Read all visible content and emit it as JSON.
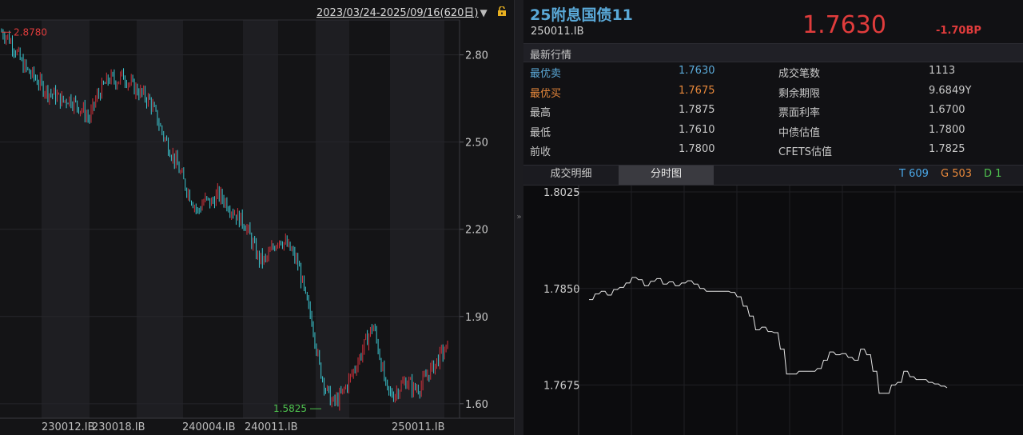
{
  "left_chart": {
    "date_range": "2023/03/24-2025/09/16(620日)",
    "range_menu_icon": "triangle-down",
    "lock_icon": "lock",
    "high_marker": "2.8780",
    "low_marker": "1.5825",
    "y_ticks": [
      "2.80",
      "2.50",
      "2.20",
      "1.90",
      "1.60"
    ],
    "x_labels": [
      "230012.IB",
      "230018.IB",
      "240004.IB",
      "240011.IB",
      "250011.IB"
    ],
    "up_color": "#d2323c",
    "down_color": "#3cc8d2"
  },
  "splitter_icon": "»",
  "header": {
    "bond_name": "25附息国债11",
    "bond_code": "250011.IB",
    "last_price": "1.7630",
    "change_bp": "-1.70BP"
  },
  "quote_section": {
    "title": "最新行情",
    "rows": [
      {
        "label1": "最优卖",
        "value1": "1.7630",
        "label2": "成交笔数",
        "value2": "1113"
      },
      {
        "label1": "最优买",
        "value1": "1.7675",
        "label2": "剩余期限",
        "value2": "9.6849Y"
      },
      {
        "label1": "最高",
        "value1": "1.7875",
        "label2": "票面利率",
        "value2": "1.6700"
      },
      {
        "label1": "最低",
        "value1": "1.7610",
        "label2": "中债估值",
        "value2": "1.7800"
      },
      {
        "label1": "前收",
        "value1": "1.7800",
        "label2": "CFETS估值",
        "value2": "1.7825"
      }
    ]
  },
  "tabs": {
    "trade_details": "成交明细",
    "intraday": "分时图",
    "t_count": "T 609",
    "g_count": "G 503",
    "d_count": "D 1"
  },
  "colors": {
    "accent_blue": "#5aa9d8",
    "price_red": "#e03c3c",
    "ask_color": "#5aa9d8",
    "bid_color": "#e8883a",
    "t_color": "#4aa8e8",
    "g_color": "#e8883a",
    "d_color": "#4fc34f"
  },
  "chart_data": [
    {
      "type": "candlestick",
      "title": "2023/03/24-2025/09/16(620日)",
      "y_ticks": [
        2.8,
        2.5,
        2.2,
        1.9,
        1.6
      ],
      "ylim": [
        1.55,
        2.92
      ],
      "x_labels": [
        "230012.IB",
        "230018.IB",
        "240004.IB",
        "240011.IB",
        "250011.IB"
      ],
      "annotations": [
        {
          "label": "2.8780",
          "y": 2.878
        },
        {
          "label": "1.5825",
          "y": 1.5825
        }
      ],
      "trend_values": [
        2.88,
        2.86,
        2.82,
        2.77,
        2.74,
        2.72,
        2.69,
        2.67,
        2.66,
        2.64,
        2.65,
        2.63,
        2.61,
        2.58,
        2.65,
        2.69,
        2.72,
        2.71,
        2.73,
        2.7,
        2.68,
        2.66,
        2.64,
        2.58,
        2.52,
        2.47,
        2.42,
        2.36,
        2.31,
        2.26,
        2.3,
        2.29,
        2.32,
        2.3,
        2.27,
        2.24,
        2.22,
        2.16,
        2.1,
        2.09,
        2.13,
        2.17,
        2.15,
        2.12,
        2.07,
        1.96,
        1.88,
        1.73,
        1.65,
        1.6,
        1.62,
        1.66,
        1.71,
        1.76,
        1.82,
        1.87,
        1.76,
        1.64,
        1.63,
        1.66,
        1.68,
        1.65,
        1.66,
        1.7,
        1.73,
        1.77,
        1.79
      ]
    },
    {
      "type": "line",
      "title": "分时图",
      "y_ticks": [
        1.8025,
        1.785,
        1.7675
      ],
      "ylim": [
        1.757,
        1.8025
      ],
      "values": [
        1.783,
        1.784,
        1.7845,
        1.7838,
        1.7848,
        1.7852,
        1.786,
        1.787,
        1.7866,
        1.7855,
        1.7863,
        1.7868,
        1.7858,
        1.7862,
        1.7855,
        1.786,
        1.7864,
        1.7858,
        1.785,
        1.7845,
        1.7845,
        1.7845,
        1.7845,
        1.7843,
        1.7835,
        1.7818,
        1.78,
        1.7775,
        1.778,
        1.7772,
        1.777,
        1.774,
        1.7695,
        1.7695,
        1.77,
        1.77,
        1.77,
        1.7705,
        1.772,
        1.7735,
        1.773,
        1.7732,
        1.7725,
        1.772,
        1.774,
        1.773,
        1.77,
        1.766,
        1.766,
        1.7675,
        1.768,
        1.77,
        1.769,
        1.7685,
        1.7685,
        1.768,
        1.7677,
        1.7673,
        1.767
      ]
    }
  ]
}
